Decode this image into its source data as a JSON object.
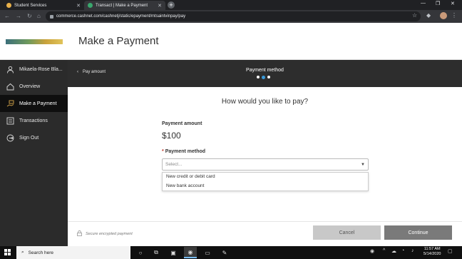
{
  "browser": {
    "tabs": [
      {
        "label": "Student Services",
        "active": false
      },
      {
        "label": "Transact | Make a Payment",
        "active": true
      }
    ],
    "url": "commerce.cashnet.com/cashnetj/static/epayment/mtsaintvinpay/pay"
  },
  "header": {
    "title": "Make a Payment"
  },
  "sidebar": {
    "items": [
      {
        "label": "Mikaela-Rose Bla...",
        "icon": "person-icon"
      },
      {
        "label": "Overview",
        "icon": "home-icon"
      },
      {
        "label": "Make a Payment",
        "icon": "payment-hand-icon",
        "active": true
      },
      {
        "label": "Transactions",
        "icon": "list-icon"
      },
      {
        "label": "Sign Out",
        "icon": "signout-icon"
      }
    ]
  },
  "progress": {
    "back_label": "Pay amount",
    "step_title": "Payment method",
    "steps_total": 3,
    "current_step": 2
  },
  "main": {
    "question": "How would you like to pay?",
    "amount_label": "Payment amount",
    "amount_value": "$100",
    "method_required_mark": "*",
    "method_label": "Payment method",
    "select_placeholder": "Select...",
    "options": [
      "New credit or debit card",
      "New bank account"
    ]
  },
  "footer": {
    "secure_text": "Secure encrypted payment",
    "cancel_label": "Cancel",
    "continue_label": "Continue"
  },
  "taskbar": {
    "search_placeholder": "Search here",
    "time": "11:57 AM",
    "date": "5/14/2020"
  },
  "colors": {
    "sidebar_bg": "#2b2b2b",
    "progress_bg": "#2d2d2d",
    "current_step": "#3a9ad9",
    "required": "#c0392b"
  }
}
